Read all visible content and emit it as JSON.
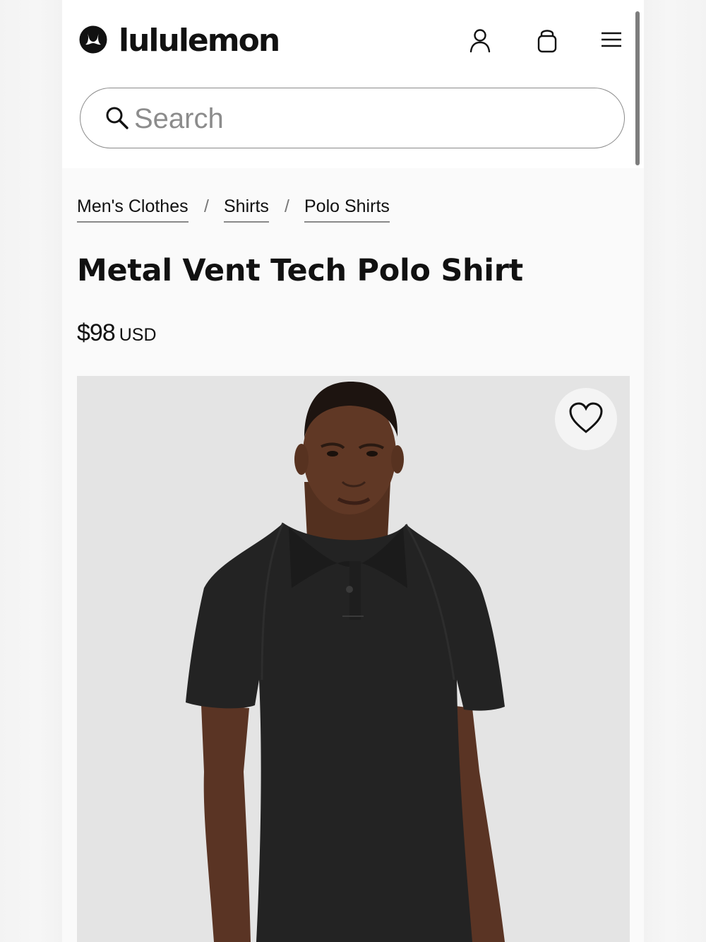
{
  "brand": {
    "name": "lululemon"
  },
  "header": {
    "icons": [
      "account-icon",
      "shopping-bag-icon",
      "menu-icon"
    ]
  },
  "search": {
    "placeholder": "Search",
    "value": ""
  },
  "breadcrumb": {
    "items": [
      "Men's Clothes",
      "Shirts",
      "Polo Shirts"
    ],
    "separator": "/"
  },
  "product": {
    "title": "Metal Vent Tech Polo Shirt",
    "price": "$98",
    "currency": "USD",
    "image_subject": "product-photo-model-black-polo",
    "wishlist_icon": "heart-icon"
  },
  "colors": {
    "accent": "#111111",
    "page_bg": "#fafafa",
    "header_bg": "#ffffff",
    "image_bg": "#e6e6e6",
    "shirt": "#232323"
  }
}
